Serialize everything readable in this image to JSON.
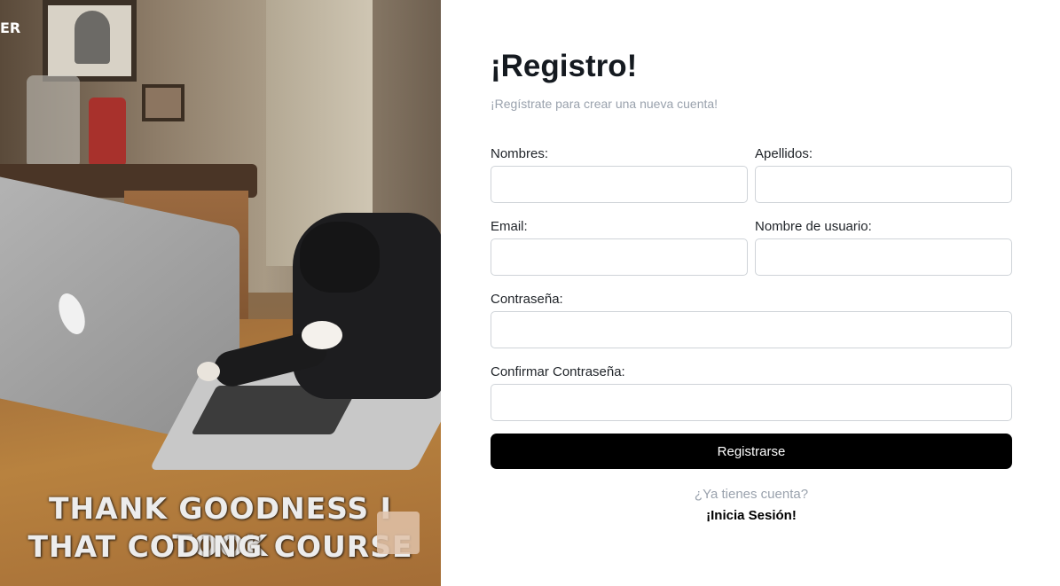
{
  "hero": {
    "watermark": "ER",
    "caption_line1": "THANK GOODNESS I TOOK",
    "caption_line2": "THAT CODING COURSE"
  },
  "form": {
    "title": "¡Registro!",
    "subtitle": "¡Regístrate para crear una nueva cuenta!",
    "fields": {
      "nombres": {
        "label": "Nombres:",
        "value": ""
      },
      "apellidos": {
        "label": "Apellidos:",
        "value": ""
      },
      "email": {
        "label": "Email:",
        "value": ""
      },
      "usuario": {
        "label": "Nombre de usuario:",
        "value": ""
      },
      "password": {
        "label": "Contraseña:",
        "value": ""
      },
      "confirm": {
        "label": "Confirmar Contraseña:",
        "value": ""
      }
    },
    "submit_label": "Registrarse",
    "have_account_text": "¿Ya tienes cuenta?",
    "login_link_label": "¡Inicia Sesión!"
  },
  "colors": {
    "title": "#151a20",
    "muted": "#9aa2ad",
    "button_bg": "#000000",
    "button_text": "#ffffff",
    "input_border": "#cfd3d8"
  }
}
